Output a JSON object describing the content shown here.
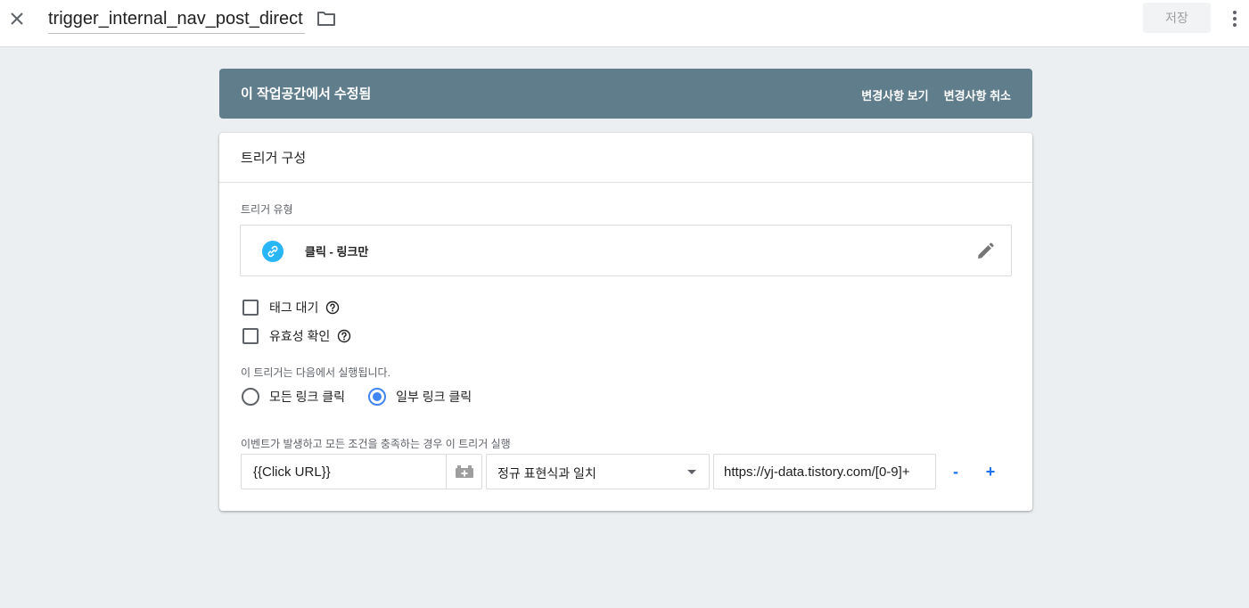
{
  "header": {
    "title": "trigger_internal_nav_post_direct",
    "save_label": "저장",
    "icons": {
      "close": "close-icon",
      "folder": "folder-icon",
      "more": "more-vert-icon"
    }
  },
  "banner": {
    "text": "이 작업공간에서 수정됨",
    "view_changes": "변경사항 보기",
    "revert_changes": "변경사항 취소"
  },
  "card": {
    "title": "트리거 구성",
    "trigger_type_label": "트리거 유형",
    "trigger_type_value": "클릭 - 링크만",
    "checkboxes": [
      {
        "label": "태그 대기",
        "checked": false
      },
      {
        "label": "유효성 확인",
        "checked": false
      }
    ],
    "fires_on_label": "이 트리거는 다음에서 실행됩니다.",
    "radios": [
      {
        "label": "모든 링크 클릭",
        "checked": false
      },
      {
        "label": "일부 링크 클릭",
        "checked": true
      }
    ],
    "condition_label": "이벤트가 발생하고 모든 조건을 충족하는 경우 이 트리거 실행",
    "condition": {
      "variable": "{{Click URL}}",
      "operator": "정규 표현식과 일치",
      "value": "https://yj-data.tistory.com/[0-9]+",
      "minus": "-",
      "plus": "+"
    }
  },
  "colors": {
    "banner": "#607d8b",
    "accent": "#4285f4",
    "link_icon": "#29b6f6",
    "background": "#eceff1"
  }
}
